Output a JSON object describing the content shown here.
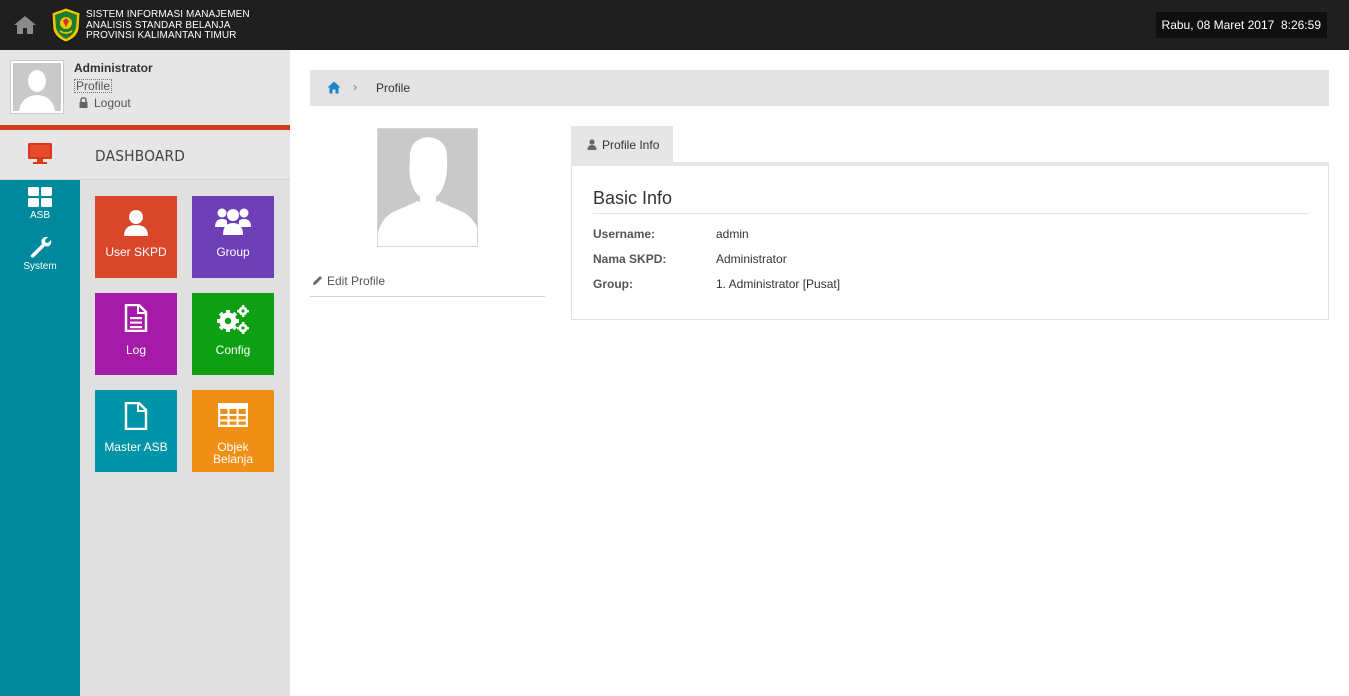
{
  "header": {
    "title_lines": [
      "SISTEM INFORMASI MANAJEMEN",
      "ANALISIS STANDAR BELANJA",
      "PROVINSI KALIMANTAN TIMUR"
    ],
    "datetime": "Rabu, 08 Maret 2017  8:26:59",
    "home_icon": "home-icon",
    "logo": "provincial-emblem"
  },
  "user": {
    "name": "Administrator",
    "profile_link": "Profile",
    "logout_link": "Logout"
  },
  "sidebar": {
    "dashboard_label": "DASHBOARD",
    "strip": [
      {
        "label": "ASB",
        "icon": "grid-icon"
      },
      {
        "label": "System",
        "icon": "wrench-icon"
      }
    ],
    "tiles": [
      {
        "label": "User SKPD",
        "icon": "user-icon",
        "color": "#d9472b"
      },
      {
        "label": "Group",
        "icon": "users-icon",
        "color": "#6f3fb8"
      },
      {
        "label": "Log",
        "icon": "document-icon",
        "color": "#a61aa8"
      },
      {
        "label": "Config",
        "icon": "gears-icon",
        "color": "#0ea013"
      },
      {
        "label": "Master ASB",
        "icon": "file-icon",
        "color": "#0094a8"
      },
      {
        "label": "Objek Belanja",
        "icon": "table-icon",
        "color": "#ef8f16"
      }
    ]
  },
  "breadcrumb": {
    "separator": "›",
    "current": "Profile"
  },
  "profile": {
    "edit_label": "Edit Profile",
    "tab_label": "Profile Info",
    "section_title": "Basic Info",
    "fields": [
      {
        "label": "Username:",
        "value": "admin"
      },
      {
        "label": "Nama SKPD:",
        "value": "Administrator"
      },
      {
        "label": "Group:",
        "value": "1. Administrator [Pusat]"
      }
    ]
  },
  "colors": {
    "topbar": "#1f1f1f",
    "accent_red": "#d9391b",
    "strip_teal": "#00899c",
    "link_blue": "#1a86c9"
  }
}
